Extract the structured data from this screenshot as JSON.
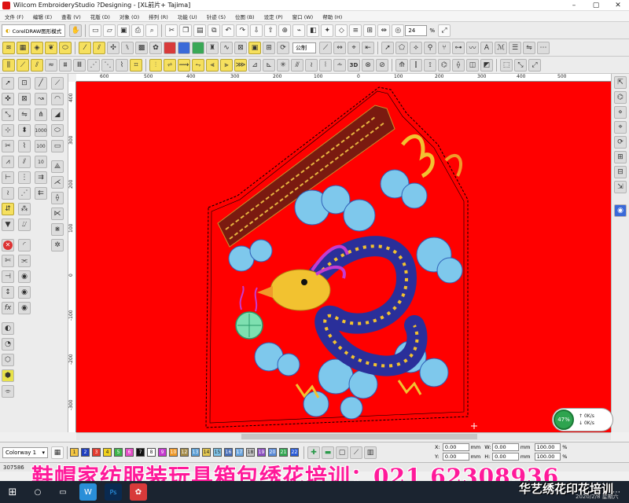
{
  "window": {
    "title": "Wilcom EmbroideryStudio ?Designing - [XL前片+          Tajima]",
    "controls": [
      "–",
      "▢",
      "✕"
    ]
  },
  "menu": [
    "文件 (F)",
    "编辑 (E)",
    "查看 (V)",
    "花版 (D)",
    "对象 (O)",
    "排列 (R)",
    "功能 (U)",
    "针迹 (S)",
    "位图 (B)",
    "设定 (P)",
    "窗口 (W)",
    "帮助 (H)"
  ],
  "toolbar": {
    "coreldraw_label": "CorelDRAW图形模式",
    "zoom_value": "24",
    "zoom_unit": "%",
    "mode_select": "公制"
  },
  "ruler": {
    "h_ticks": [
      "600",
      "500",
      "400",
      "300",
      "200",
      "100",
      "0",
      "100",
      "200",
      "300",
      "400",
      "500"
    ],
    "v_ticks": [
      "400",
      "300",
      "200",
      "100",
      "0",
      "-100",
      "-200",
      "-300"
    ]
  },
  "colorway": {
    "selected": "Colorway 1",
    "swatches": [
      {
        "num": "1",
        "color": "#f4c542"
      },
      {
        "num": "2",
        "color": "#1f3fbf"
      },
      {
        "num": "3",
        "color": "#e33b2e"
      },
      {
        "num": "4",
        "color": "#f2d21c"
      },
      {
        "num": "5",
        "color": "#3fb54a"
      },
      {
        "num": "6",
        "color": "#e44fc7"
      },
      {
        "num": "7",
        "color": "#111111"
      },
      {
        "num": "8",
        "color": "#ffffff"
      },
      {
        "num": "9",
        "color": "#c63bd0"
      },
      {
        "num": "10",
        "color": "#f09a2a"
      },
      {
        "num": "12",
        "color": "#a58c4a"
      },
      {
        "num": "13",
        "color": "#5b9fd6"
      },
      {
        "num": "14",
        "color": "#e2c64f"
      },
      {
        "num": "15",
        "color": "#7ec3e8"
      },
      {
        "num": "16",
        "color": "#4a6fb8"
      },
      {
        "num": "17",
        "color": "#6aa5e0"
      },
      {
        "num": "18",
        "color": "#c0c0c0"
      },
      {
        "num": "19",
        "color": "#8c4fc0"
      },
      {
        "num": "20",
        "color": "#5b8bd8"
      },
      {
        "num": "21",
        "color": "#34a853"
      },
      {
        "num": "22",
        "color": "#2a5bd7"
      }
    ]
  },
  "coords": {
    "x_label": "X:",
    "x_value": "0.00",
    "x_unit": "mm",
    "y_label": "Y:",
    "y_value": "0.00",
    "y_unit": "mm",
    "w_label": "W:",
    "w_value": "0.00",
    "w_unit": "mm",
    "h_label": "H:",
    "h_value": "0.00",
    "h_unit": "mm",
    "pct1": "100.00",
    "pct1_unit": "%",
    "pct2": "100.00",
    "pct2_unit": "%"
  },
  "status": {
    "stitch_count": "307586"
  },
  "banner": "鞋帽家纺服装玩具箱包绣花培训：021 62308936",
  "watermark": "华艺绣花印花培训",
  "clock": "2020/2/8 星期六",
  "network": {
    "percent": "47%",
    "up": "0K/s",
    "down": "0K/s"
  },
  "colors": {
    "canvas_bg": "#ff0000",
    "accent_yellow": "#f6e05e"
  }
}
